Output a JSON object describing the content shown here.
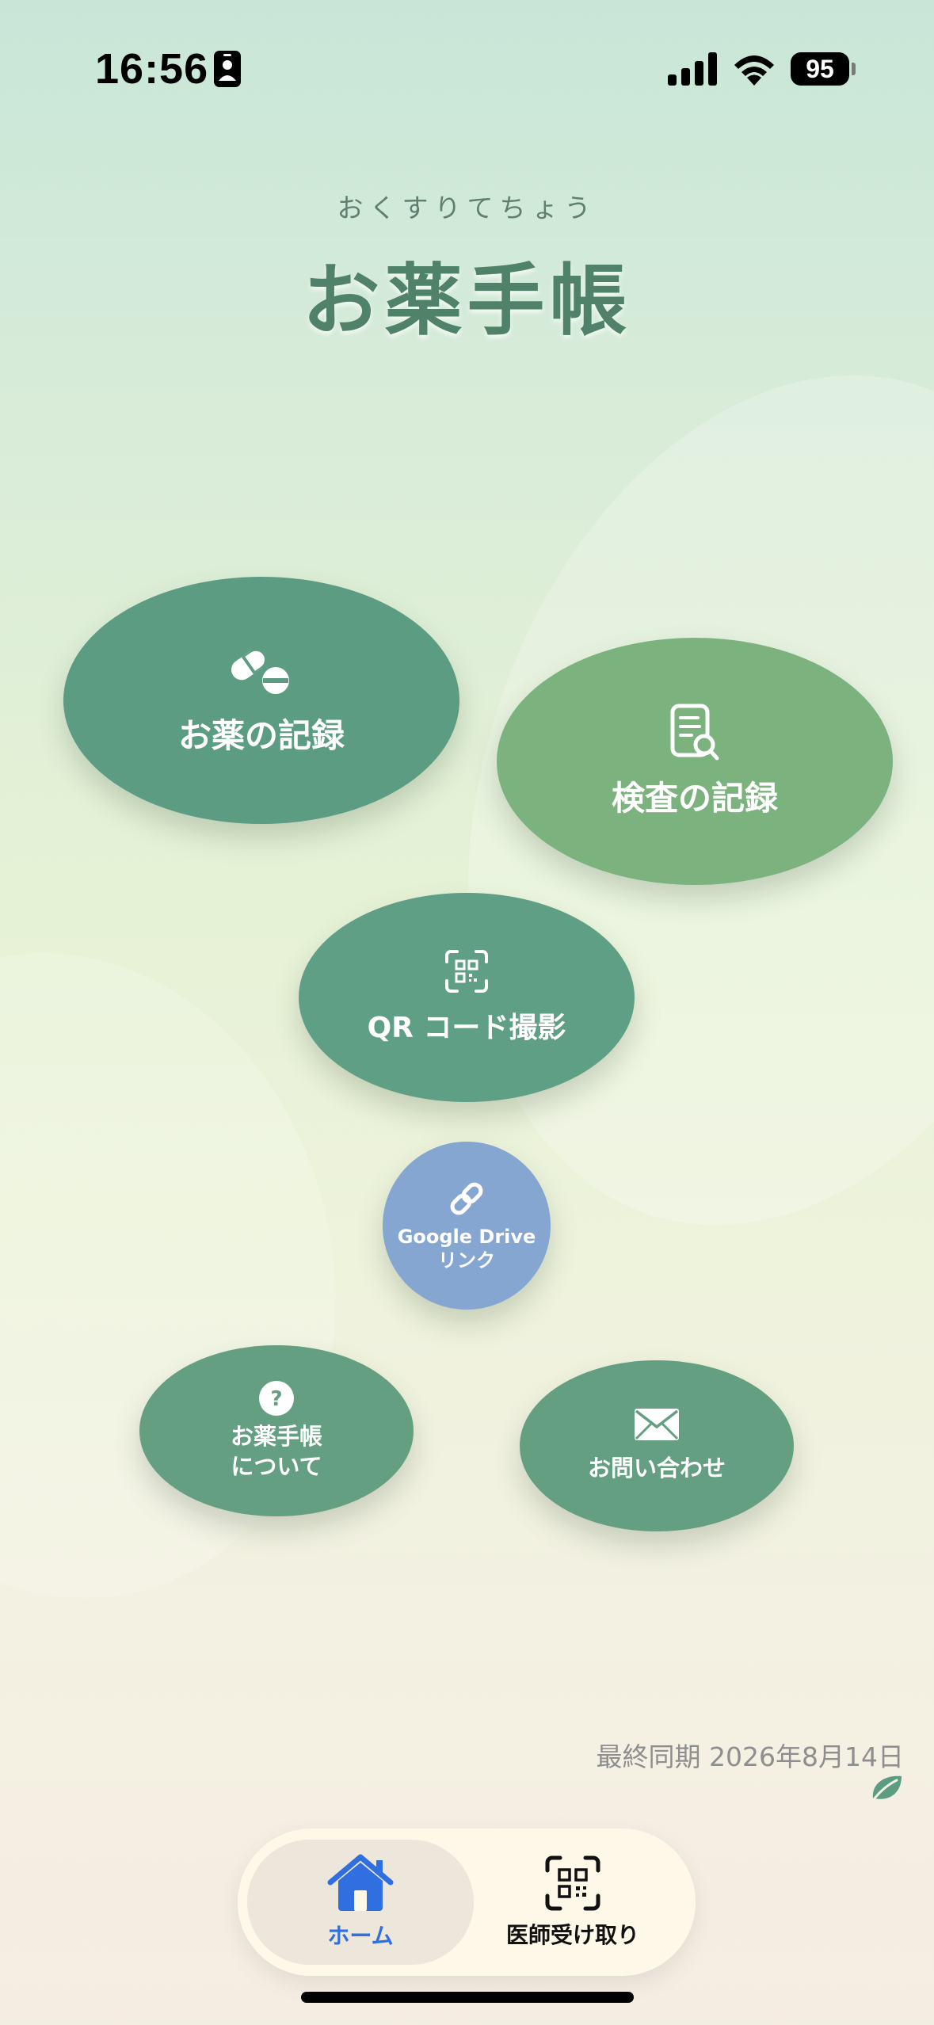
{
  "status_bar": {
    "time": "16:56",
    "battery": "95"
  },
  "header": {
    "subtitle": "おくすりてちょう",
    "title": "お薬手帳"
  },
  "menu": {
    "medicine_record": {
      "label": "お薬の記録",
      "icon": "pill-icon",
      "color": "#5c9c82"
    },
    "test_record": {
      "label": "検査の記録",
      "icon": "document-search-icon",
      "color": "#7bb27d"
    },
    "qr_capture": {
      "label": "QR コード撮影",
      "icon": "qr-scan-icon",
      "color": "#5f9f85"
    },
    "google_drive": {
      "label_line1": "Google Drive",
      "label_line2": "リンク",
      "icon": "link-icon",
      "color": "#86a6d2"
    },
    "about": {
      "label_line1": "お薬手帳",
      "label_line2": "について",
      "icon": "question-icon",
      "color": "#649f82"
    },
    "contact": {
      "label": "お問い合わせ",
      "icon": "mail-icon",
      "color": "#649f82"
    }
  },
  "sync": {
    "text": "最終同期 2026年8月14日",
    "icon": "leaf-icon"
  },
  "tabbar": {
    "home": {
      "label": "ホーム",
      "icon": "home-icon",
      "active": true,
      "color": "#2f6fe0"
    },
    "doctor": {
      "label": "医師受け取り",
      "icon": "qr-code-icon",
      "active": false
    }
  }
}
